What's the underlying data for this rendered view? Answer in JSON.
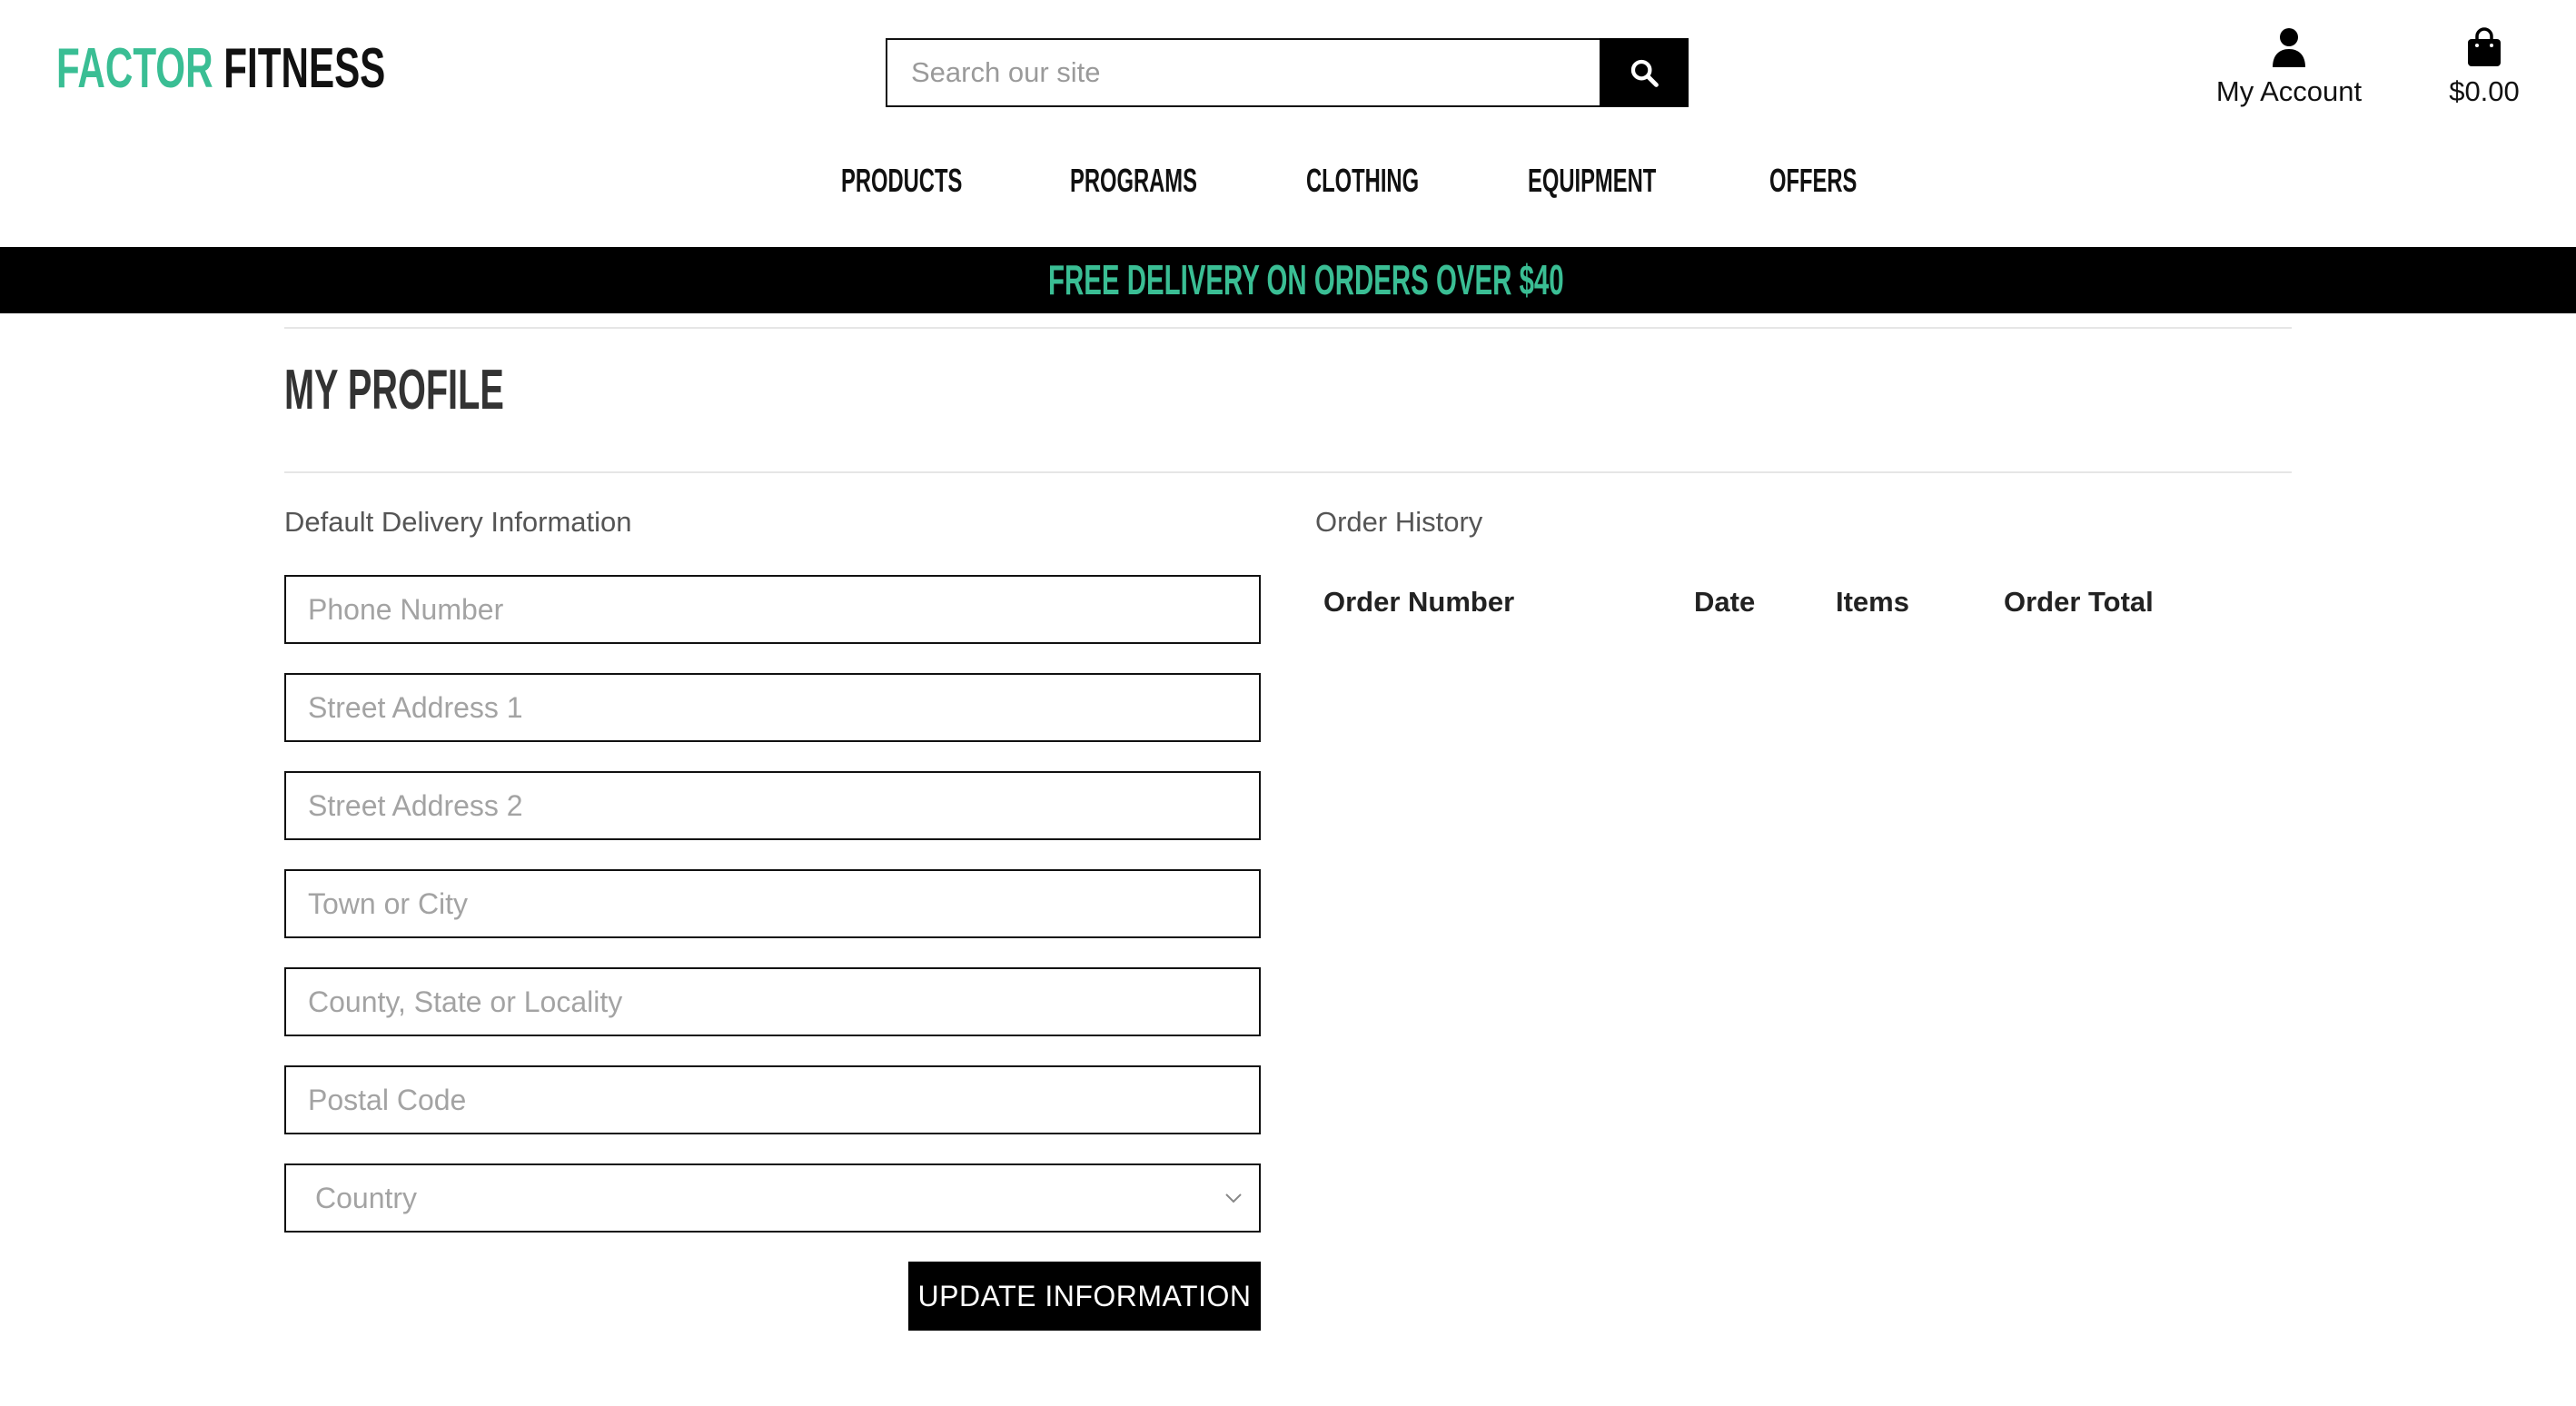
{
  "brand": {
    "part1": "FACTOR",
    "part2": "FITNESS",
    "accent_color": "#3abe94"
  },
  "search": {
    "placeholder": "Search our site",
    "icon": "search-icon"
  },
  "header": {
    "account_label": "My Account",
    "account_icon": "user-icon",
    "bag_total": "$0.00",
    "bag_icon": "shopping-bag-icon"
  },
  "nav": {
    "items": [
      "PRODUCTS",
      "PROGRAMS",
      "CLOTHING",
      "EQUIPMENT",
      "OFFERS"
    ]
  },
  "banner": {
    "text": "FREE DELIVERY ON ORDERS OVER $40"
  },
  "profile": {
    "title": "MY PROFILE",
    "delivery_heading": "Default Delivery Information",
    "fields": {
      "phone": "Phone Number",
      "street1": "Street Address 1",
      "street2": "Street Address 2",
      "town": "Town or City",
      "county": "County, State or Locality",
      "postcode": "Postal Code",
      "country": "Country"
    },
    "update_button": "UPDATE INFORMATION"
  },
  "order_history": {
    "heading": "Order History",
    "columns": [
      "Order Number",
      "Date",
      "Items",
      "Order Total"
    ],
    "rows": []
  }
}
